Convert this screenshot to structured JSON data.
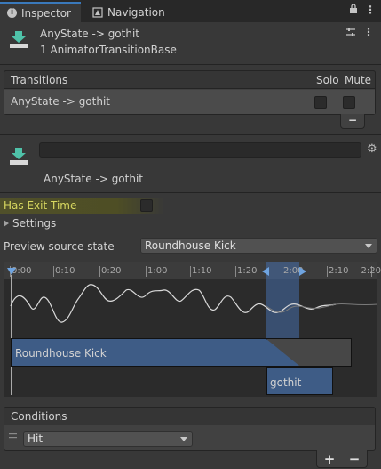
{
  "tabs": [
    {
      "label": "Inspector",
      "icon": "info-icon",
      "active": true
    },
    {
      "label": "Navigation",
      "icon": "nav-icon",
      "active": false
    }
  ],
  "header": {
    "title": "AnyState -> gothit",
    "subtitle": "1 AnimatorTransitionBase"
  },
  "transitions": {
    "heading": "Transitions",
    "col_solo": "Solo",
    "col_mute": "Mute",
    "rows": [
      {
        "label": "AnyState -> gothit",
        "solo": false,
        "mute": false
      }
    ],
    "remove_label": "−"
  },
  "transition_detail": {
    "name_value": "",
    "label": "AnyState -> gothit"
  },
  "has_exit_time": {
    "label": "Has Exit Time",
    "checked": false
  },
  "settings_label": "Settings",
  "preview": {
    "label": "Preview source state",
    "value": "Roundhouse Kick"
  },
  "timeline": {
    "ticks": [
      "0:00",
      "0:10",
      "0:20",
      "1:00",
      "1:10",
      "1:20",
      "2:00",
      "2:10",
      "2:20"
    ],
    "clip_a": "Roundhouse Kick",
    "clip_b": "gothit"
  },
  "conditions": {
    "heading": "Conditions",
    "items": [
      {
        "param": "Hit"
      }
    ],
    "add_label": "+",
    "remove_label": "−"
  },
  "colors": {
    "accent": "#3a79bb",
    "clip": "#3e5c86",
    "exit_highlight": "#c8c800"
  }
}
